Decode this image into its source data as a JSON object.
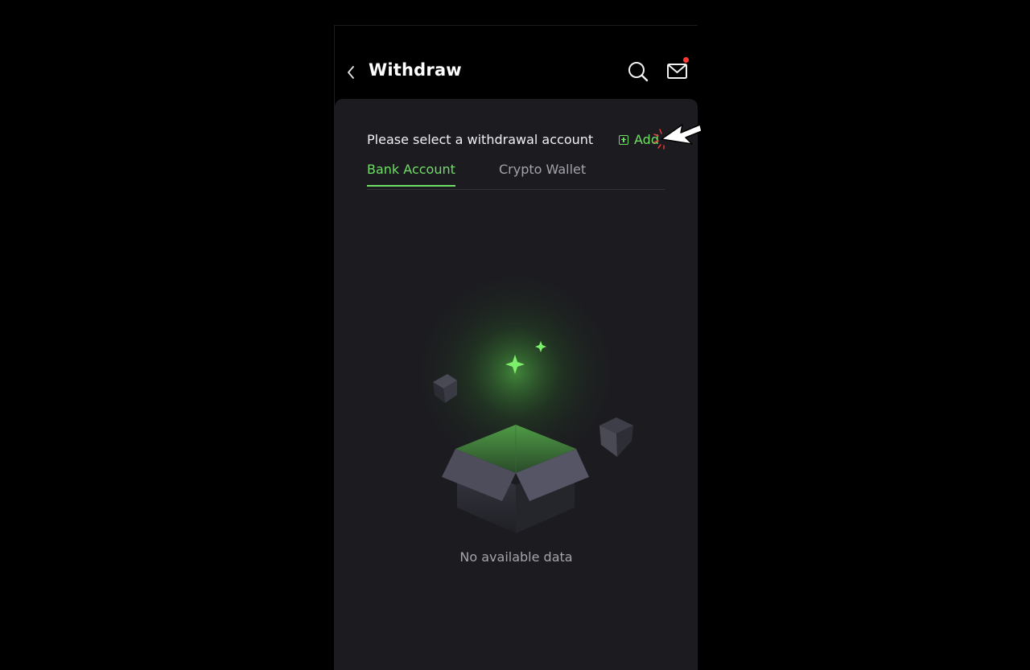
{
  "header": {
    "title": "Withdraw"
  },
  "account_select": {
    "label": "Please select a withdrawal account",
    "add_label": "Add"
  },
  "tabs": [
    {
      "label": "Bank Account",
      "active": true
    },
    {
      "label": "Crypto Wallet",
      "active": false
    }
  ],
  "empty_state": {
    "message": "No available data"
  },
  "colors": {
    "accent": "#6fdf65",
    "panel": "#1c1c20",
    "background": "#000000",
    "notification": "#ff3838"
  },
  "icons": [
    "back-arrow-icon",
    "search-icon",
    "mail-icon",
    "plus-square-icon",
    "empty-box-icon",
    "pointer-cursor-icon"
  ]
}
